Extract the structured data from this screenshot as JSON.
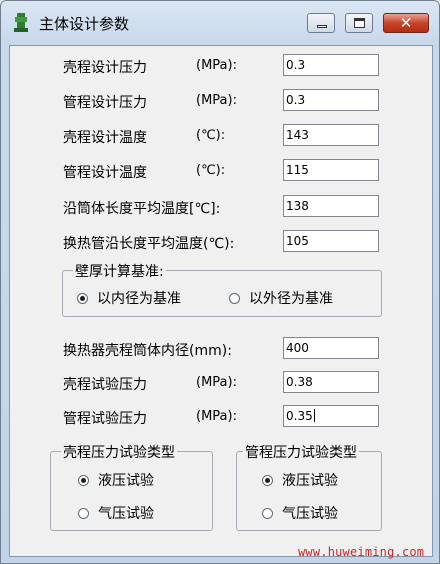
{
  "window": {
    "title": "主体设计参数",
    "close_glyph": "✕"
  },
  "fields": [
    {
      "label": "壳程设计压力",
      "unit": "(MPa):",
      "value": "0.3"
    },
    {
      "label": "管程设计压力",
      "unit": "(MPa):",
      "value": "0.3"
    },
    {
      "label": "壳程设计温度",
      "unit": "(℃):",
      "value": "143"
    },
    {
      "label": "管程设计温度",
      "unit": "(℃):",
      "value": "115"
    },
    {
      "label": "沿筒体长度平均温度[℃]:",
      "unit": "",
      "value": "138"
    },
    {
      "label": "换热管沿长度平均温度(℃):",
      "unit": "",
      "value": "105"
    }
  ],
  "wall_basis": {
    "title": "壁厚计算基准:",
    "options": [
      "以内径为基准",
      "以外径为基准"
    ],
    "selected": 0
  },
  "fields2": [
    {
      "label": "换热器壳程筒体内径(mm):",
      "unit": "",
      "value": "400"
    },
    {
      "label": "壳程试验压力",
      "unit": "(MPa):",
      "value": "0.38"
    },
    {
      "label": "管程试验压力",
      "unit": "(MPa):",
      "value": "0.35"
    }
  ],
  "shell_test": {
    "title": "壳程压力试验类型",
    "options": [
      "液压试验",
      "气压试验"
    ],
    "selected": 0
  },
  "tube_test": {
    "title": "管程压力试验类型",
    "options": [
      "液压试验",
      "气压试验"
    ],
    "selected": 0
  },
  "watermark": "www.huweiming.com",
  "colors": {
    "title_bar": "#c9d9ec",
    "close_button": "#c8452a",
    "watermark": "#d42020"
  }
}
